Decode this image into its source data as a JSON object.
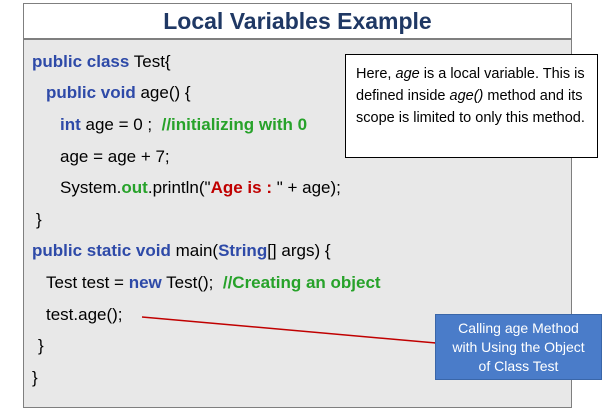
{
  "title": "Local Variables Example",
  "code": {
    "line1_kw": "public class",
    "line1_rest": " Test{",
    "line2_kw": "public void",
    "line2_rest": " age() {",
    "line3_kw": "int",
    "line3_mid": " age = 0 ;  ",
    "line3_comment": "//initializing with 0",
    "line4": "age = age + 7;",
    "line5_a": "System.",
    "line5_field": "out",
    "line5_b": ".println(\"",
    "line5_str": "Age is : ",
    "line5_c": "\" + age);",
    "line6": "}",
    "line7_kw": "public static void",
    "line7_mid": " main(",
    "line7_type": "String",
    "line7_rest": "[] args) {",
    "line8_a": "Test test = ",
    "line8_kw": "new",
    "line8_b": " Test();  ",
    "line8_comment": "//Creating an object",
    "line9": "test.age();",
    "line10": "}",
    "line11": "}"
  },
  "note": {
    "part1": "Here, ",
    "var1": "age",
    "part2": " is a local variable. This is defined inside ",
    "var2": "age()",
    "part3": " method and its scope is limited to only this method."
  },
  "callout": {
    "line1": "Calling age Method",
    "line2": "with Using the Object",
    "line3": "of Class Test"
  },
  "colors": {
    "title": "#1f3864",
    "keyword": "#2e4aa8",
    "comment": "#27a22a",
    "string": "#c00000",
    "callout_bg": "#4a7cc9",
    "arrow": "#c00000"
  }
}
